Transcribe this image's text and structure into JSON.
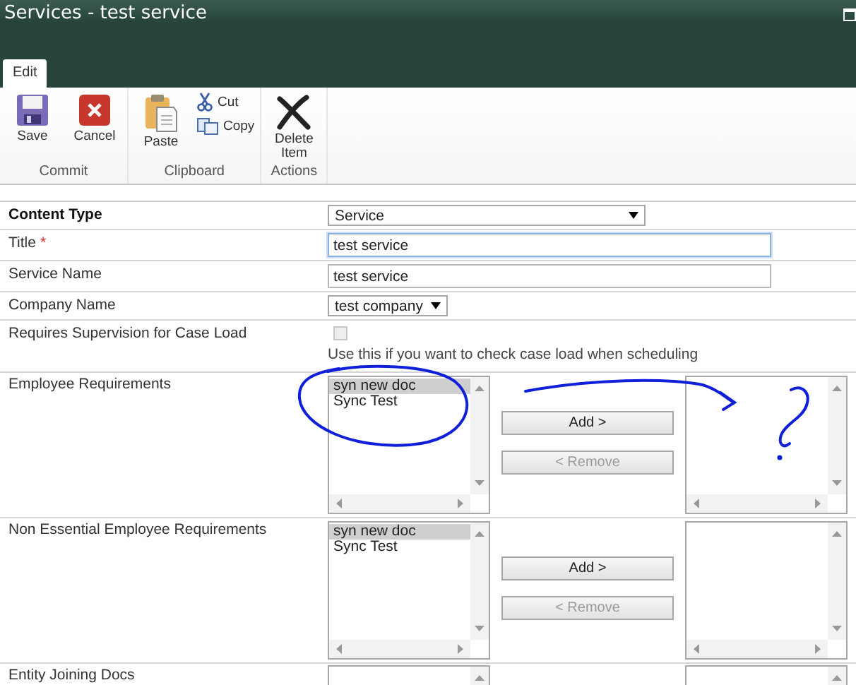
{
  "window": {
    "title": "Services - test service"
  },
  "tabs": [
    {
      "label": "Edit",
      "selected": true
    }
  ],
  "ribbon": [
    {
      "label": "Commit",
      "buttons": [
        {
          "label": "Save",
          "kind": "large"
        },
        {
          "label": "Cancel",
          "kind": "large"
        }
      ]
    },
    {
      "label": "Clipboard",
      "buttons": [
        {
          "label": "Paste",
          "kind": "large"
        },
        {
          "label": "Cut",
          "kind": "small"
        },
        {
          "label": "Copy",
          "kind": "small"
        }
      ]
    },
    {
      "label": "Actions",
      "buttons": [
        {
          "label": "Delete Item",
          "kind": "large"
        }
      ]
    }
  ],
  "fields": [
    {
      "kind": "select",
      "label": "Content Type",
      "emphasis": true,
      "full_width": true,
      "value": "Service"
    },
    {
      "kind": "text",
      "label": "Title",
      "required_mark": "*",
      "focused": true,
      "value": "test service"
    },
    {
      "kind": "text",
      "label": "Service Name",
      "focused": false,
      "value": "test service"
    },
    {
      "kind": "select",
      "label": "Company Name",
      "full_width": false,
      "value": "test company"
    },
    {
      "kind": "checkbox",
      "label": "Requires Supervision for Case Load",
      "checked": false,
      "hint": "Use this if you want to check case load when scheduling"
    },
    {
      "kind": "picker",
      "label": "Employee Requirements",
      "available": [
        {
          "text": "syn new doc",
          "selected": true
        },
        {
          "text": "Sync Test",
          "selected": false
        }
      ],
      "add": {
        "label": "Add >",
        "disabled": false
      },
      "remove": {
        "label": "< Remove",
        "disabled": true
      }
    },
    {
      "kind": "picker",
      "label": "Non Essential Employee Requirements",
      "available": [
        {
          "text": "syn new doc",
          "selected": true
        },
        {
          "text": "Sync Test",
          "selected": false
        }
      ],
      "add": {
        "label": "Add >",
        "disabled": false
      },
      "remove": {
        "label": "< Remove",
        "disabled": true
      }
    },
    {
      "kind": "picker",
      "label": "Entity Joining Docs"
    }
  ]
}
